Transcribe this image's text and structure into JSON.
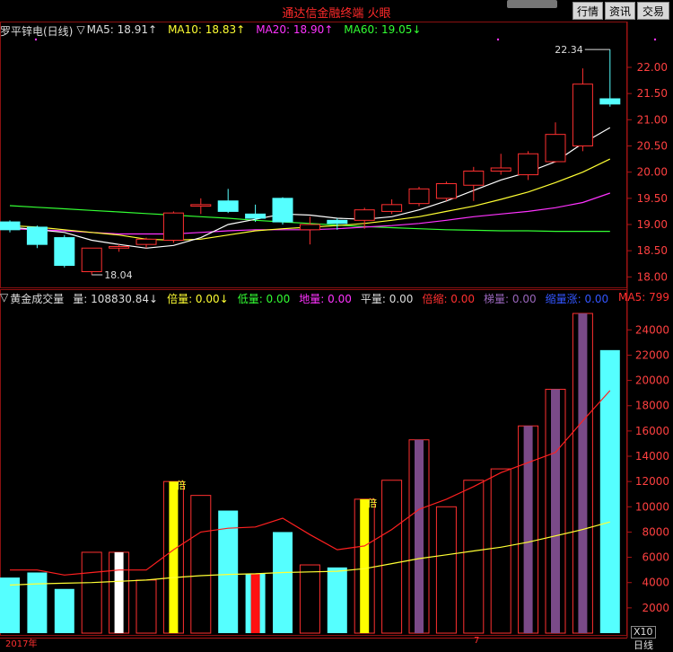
{
  "app_title": "通达信金融终端 火眼",
  "buttons": {
    "market": "行情",
    "info": "资讯",
    "trade": "交易"
  },
  "price_panel": {
    "stock_name": "罗平锌电(日线)",
    "ma_marker": "▽",
    "ma5_label": "MA5: 18.91↑",
    "ma10_label": "MA10: 18.83↑",
    "ma20_label": "MA20: 18.90↑",
    "ma60_label": "MA60: 19.05↓",
    "y_ticks": [
      "22.00",
      "21.50",
      "21.00",
      "20.50",
      "20.00",
      "19.50",
      "19.00",
      "18.50",
      "18.00"
    ],
    "high_annotation": "22.34",
    "low_annotation": "18.04",
    "colors": {
      "ma5": "#ffffff",
      "ma10": "#ffff33",
      "ma20": "#ff33ff",
      "ma60": "#33ff33",
      "up": "#ff3030",
      "down": "#55ffff"
    }
  },
  "volume_panel": {
    "marker": "▽",
    "title": "黄金成交量",
    "vol_label": "量: 108830.84↓",
    "bei_label": "倍量: 0.00↓",
    "di_label": "低量: 0.00",
    "dili_label": "地量: 0.00",
    "ping_label": "平量: 0.00",
    "suo_label": "倍缩: 0.00",
    "ti_label": "梯量: 0.00",
    "suozhang_label": "缩量涨: 0.00",
    "ma5_label": "MA5: 799",
    "y_ticks": [
      "24000",
      "22000",
      "20000",
      "18000",
      "16000",
      "14000",
      "12000",
      "10000",
      "8000",
      "6000",
      "4000",
      "2000"
    ],
    "bei_mark": "倍"
  },
  "footer": {
    "year": "2017年",
    "month": "7",
    "x10": "X10",
    "period": "日线"
  },
  "chart_data": [
    {
      "type": "candlestick",
      "title": "罗平锌电(日线)",
      "ylim": [
        17.8,
        22.6
      ],
      "candles": [
        {
          "o": 19.05,
          "h": 19.08,
          "l": 18.85,
          "c": 18.9,
          "dir": "down"
        },
        {
          "o": 18.95,
          "h": 18.98,
          "l": 18.55,
          "c": 18.62,
          "dir": "down"
        },
        {
          "o": 18.75,
          "h": 18.8,
          "l": 18.18,
          "c": 18.22,
          "dir": "down"
        },
        {
          "o": 18.1,
          "h": 18.55,
          "l": 18.04,
          "c": 18.55,
          "dir": "up"
        },
        {
          "o": 18.55,
          "h": 18.62,
          "l": 18.48,
          "c": 18.58,
          "dir": "up"
        },
        {
          "o": 18.62,
          "h": 18.75,
          "l": 18.55,
          "c": 18.72,
          "dir": "up"
        },
        {
          "o": 18.7,
          "h": 19.25,
          "l": 18.65,
          "c": 19.22,
          "dir": "up"
        },
        {
          "o": 19.35,
          "h": 19.5,
          "l": 19.2,
          "c": 19.38,
          "dir": "up"
        },
        {
          "o": 19.45,
          "h": 19.68,
          "l": 19.22,
          "c": 19.25,
          "dir": "down"
        },
        {
          "o": 19.2,
          "h": 19.38,
          "l": 19.05,
          "c": 19.12,
          "dir": "down"
        },
        {
          "o": 19.5,
          "h": 19.52,
          "l": 19.0,
          "c": 19.05,
          "dir": "down"
        },
        {
          "o": 18.9,
          "h": 19.15,
          "l": 18.62,
          "c": 19.0,
          "dir": "up"
        },
        {
          "o": 19.08,
          "h": 19.12,
          "l": 18.9,
          "c": 19.02,
          "dir": "down"
        },
        {
          "o": 19.08,
          "h": 19.32,
          "l": 18.92,
          "c": 19.28,
          "dir": "up"
        },
        {
          "o": 19.25,
          "h": 19.48,
          "l": 19.2,
          "c": 19.38,
          "dir": "up"
        },
        {
          "o": 19.4,
          "h": 19.72,
          "l": 19.35,
          "c": 19.68,
          "dir": "up"
        },
        {
          "o": 19.5,
          "h": 19.82,
          "l": 19.45,
          "c": 19.78,
          "dir": "up"
        },
        {
          "o": 19.75,
          "h": 20.1,
          "l": 19.45,
          "c": 20.02,
          "dir": "up"
        },
        {
          "o": 20.02,
          "h": 20.35,
          "l": 19.95,
          "c": 20.08,
          "dir": "up"
        },
        {
          "o": 19.95,
          "h": 20.4,
          "l": 19.85,
          "c": 20.35,
          "dir": "up"
        },
        {
          "o": 20.2,
          "h": 20.95,
          "l": 20.18,
          "c": 20.72,
          "dir": "up"
        },
        {
          "o": 20.5,
          "h": 21.98,
          "l": 20.4,
          "c": 21.68,
          "dir": "up"
        },
        {
          "o": 21.4,
          "h": 22.34,
          "l": 21.25,
          "c": 21.3,
          "dir": "down"
        }
      ],
      "ma5": [
        18.95,
        18.9,
        18.85,
        18.7,
        18.62,
        18.55,
        18.6,
        18.75,
        19.0,
        19.1,
        19.2,
        19.18,
        19.12,
        19.1,
        19.15,
        19.28,
        19.45,
        19.65,
        19.85,
        20.0,
        20.2,
        20.55,
        20.85
      ],
      "ma10": [
        18.98,
        18.95,
        18.9,
        18.85,
        18.8,
        18.72,
        18.7,
        18.72,
        18.8,
        18.88,
        18.92,
        18.95,
        18.98,
        19.02,
        19.08,
        19.15,
        19.25,
        19.35,
        19.48,
        19.62,
        19.8,
        20.0,
        20.25
      ],
      "ma20": [
        18.92,
        18.9,
        18.88,
        18.85,
        18.82,
        18.82,
        18.82,
        18.85,
        18.88,
        18.9,
        18.9,
        18.9,
        18.92,
        18.95,
        18.98,
        19.02,
        19.08,
        19.15,
        19.2,
        19.25,
        19.32,
        19.42,
        19.6
      ],
      "ma60": [
        19.36,
        19.33,
        19.3,
        19.27,
        19.24,
        19.21,
        19.18,
        19.15,
        19.12,
        19.08,
        19.05,
        19.02,
        18.99,
        18.96,
        18.94,
        18.92,
        18.9,
        18.89,
        18.88,
        18.88,
        18.87,
        18.87,
        18.87
      ]
    },
    {
      "type": "bar",
      "title": "黄金成交量",
      "ylim": [
        0,
        25800
      ],
      "volumes": [
        4400,
        4800,
        3500,
        6400,
        6400,
        4200,
        12000,
        10900,
        9700,
        4700,
        8000,
        5400,
        5200,
        10600,
        12100,
        15300,
        10000,
        12100,
        13000,
        16400,
        19300,
        25300,
        22400
      ],
      "styles": [
        "down",
        "down",
        "down",
        "up",
        "white",
        "up",
        "yellow",
        "up",
        "down",
        "red",
        "down",
        "up",
        "down",
        "yellow",
        "up",
        "purple",
        "up",
        "up",
        "up",
        "purple",
        "purple",
        "purple",
        "down"
      ],
      "ma5": [
        5000,
        5000,
        4600,
        4800,
        5000,
        5000,
        6600,
        8000,
        8300,
        8400,
        9100,
        7800,
        6600,
        6900,
        8200,
        9800,
        10600,
        11600,
        12700,
        13500,
        14300,
        16800,
        19200
      ],
      "ma_long": [
        3800,
        3900,
        3950,
        4000,
        4100,
        4200,
        4400,
        4550,
        4650,
        4700,
        4800,
        4850,
        4900,
        5100,
        5500,
        5900,
        6200,
        6500,
        6800,
        7200,
        7700,
        8200,
        8800
      ]
    }
  ]
}
